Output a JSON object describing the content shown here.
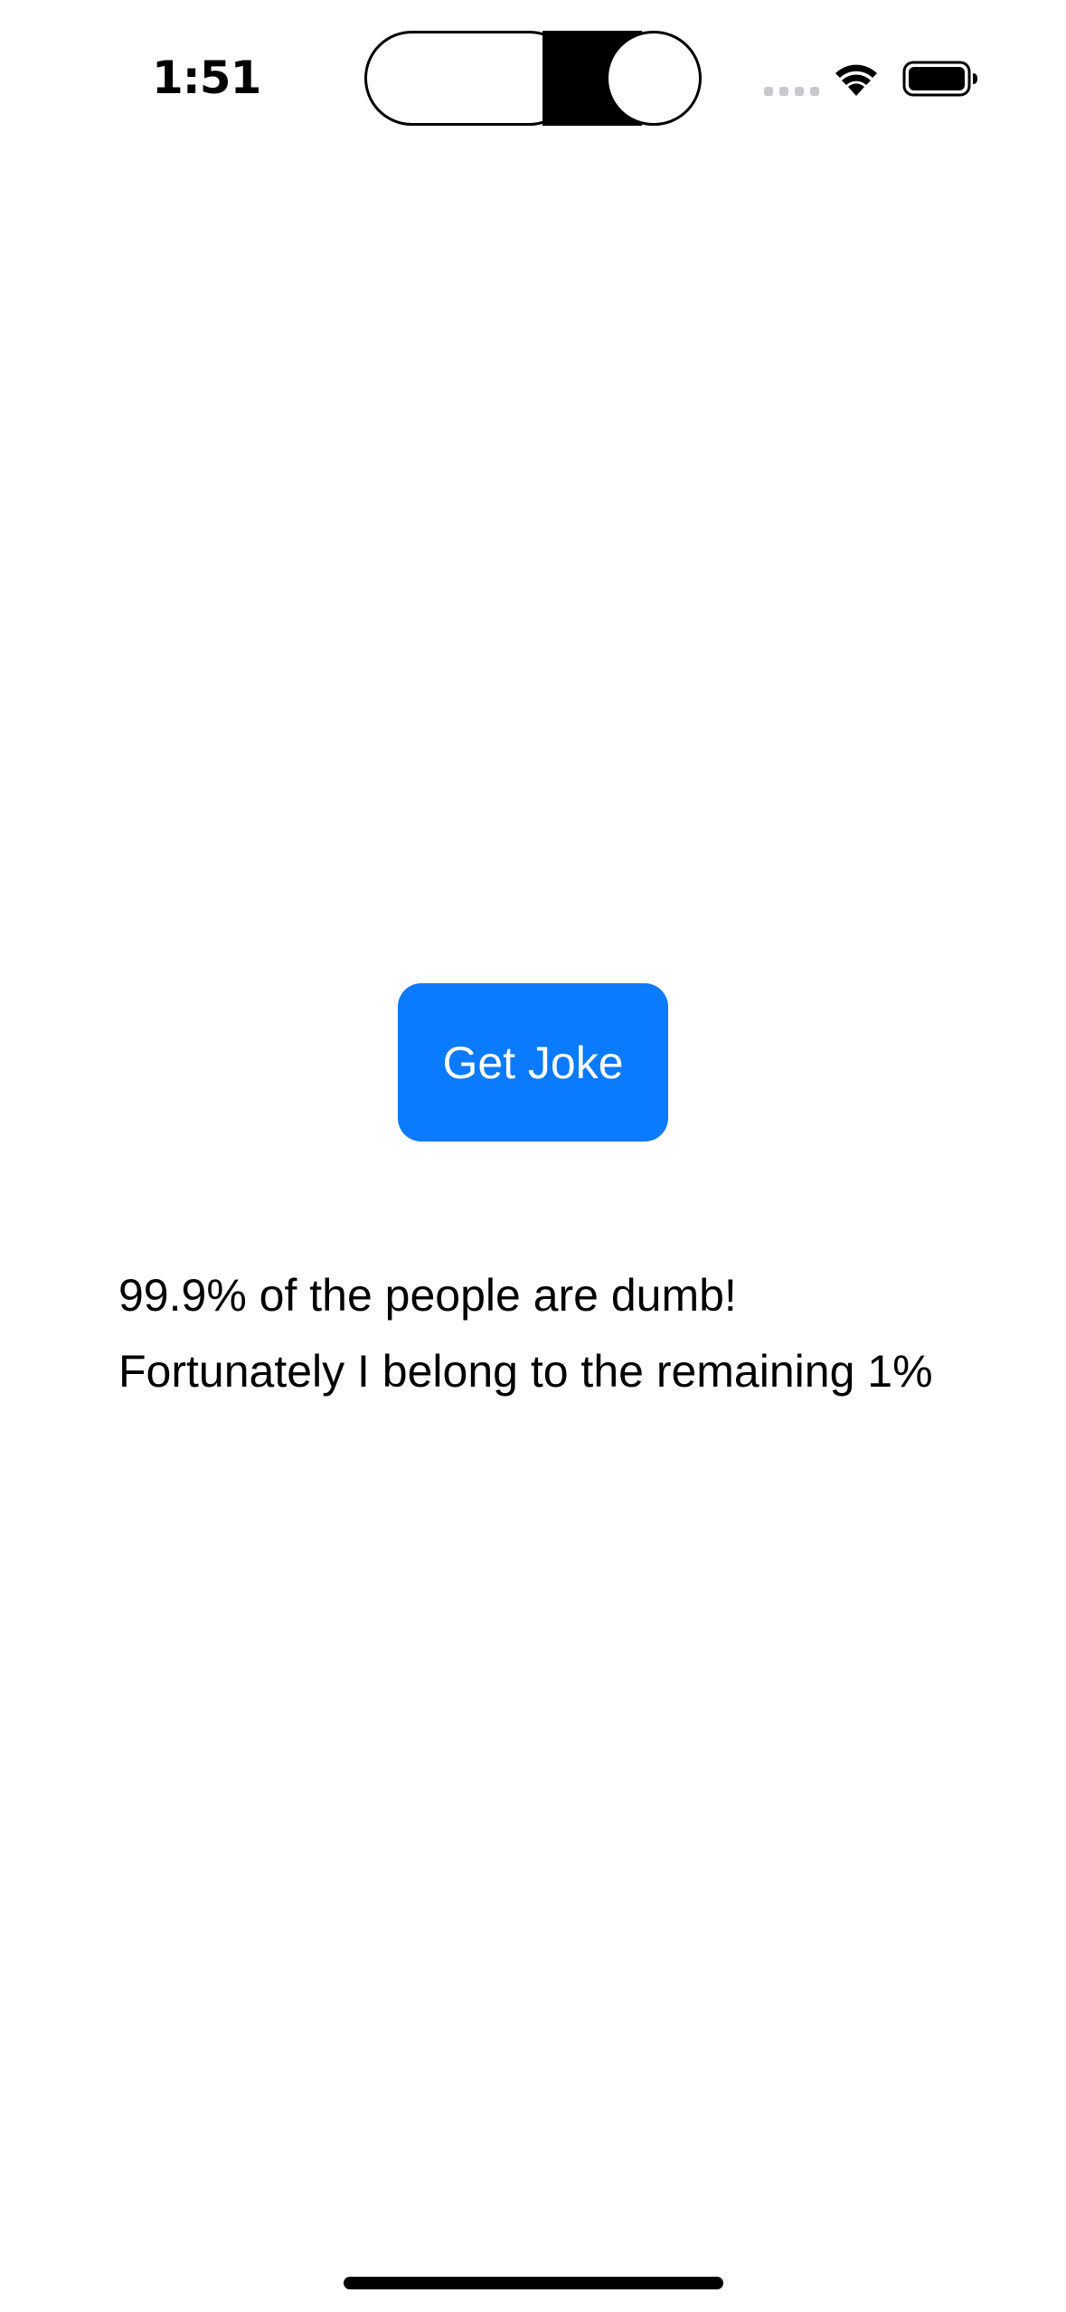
{
  "status_bar": {
    "time": "1:51",
    "signal_icon": "cellular-signal-icon",
    "wifi_icon": "wifi-icon",
    "battery_icon": "battery-icon"
  },
  "main": {
    "button_label": "Get Joke",
    "joke_lines": [
      "99.9% of the people are dumb!",
      "Fortunately I belong to the remaining 1%"
    ]
  },
  "colors": {
    "accent": "#0a7aff",
    "text": "#000000",
    "background": "#ffffff"
  }
}
